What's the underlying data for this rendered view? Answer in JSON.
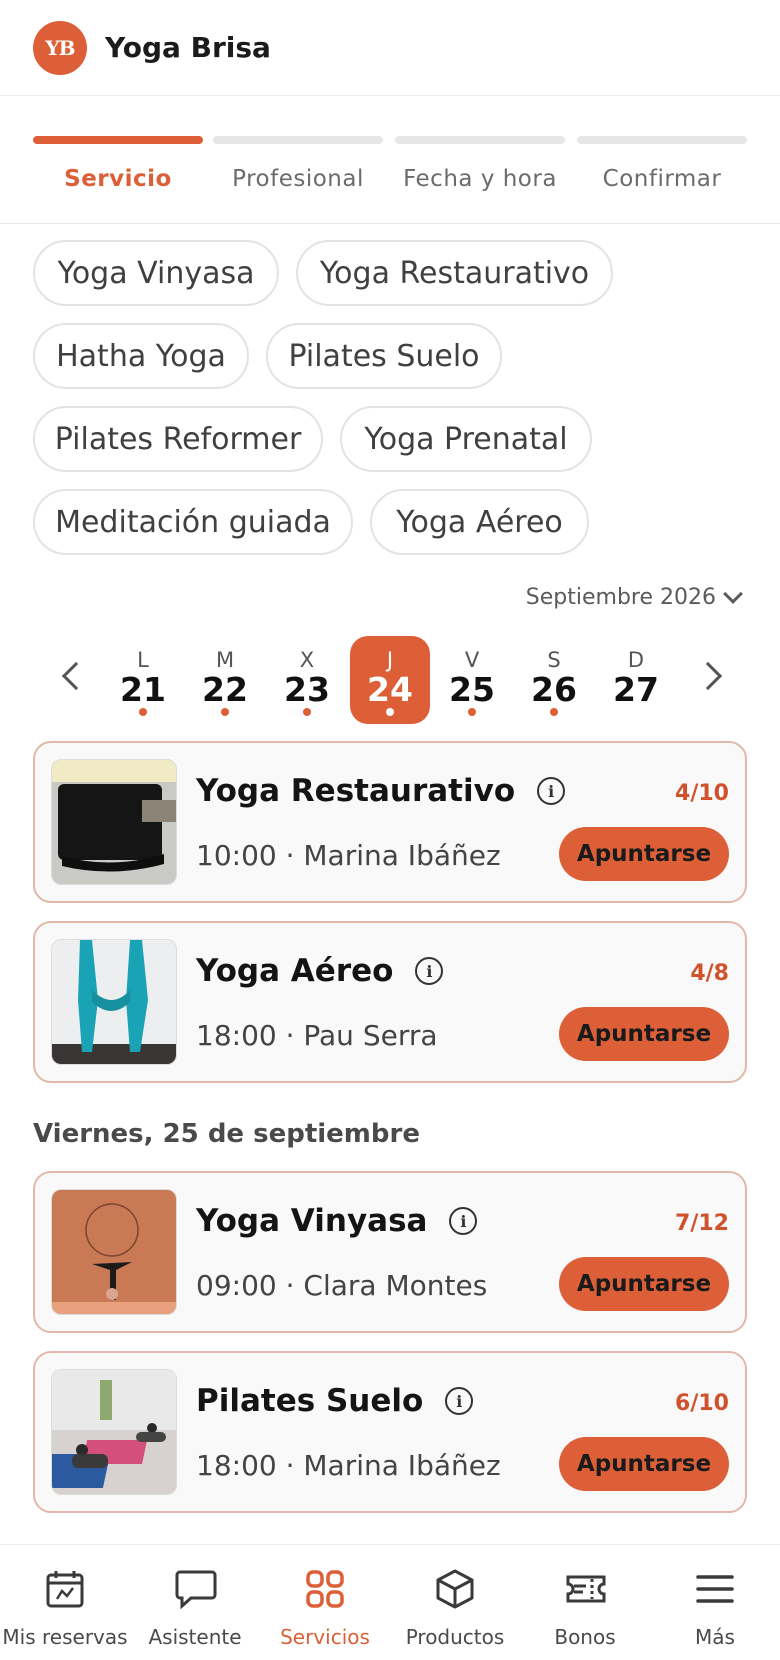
{
  "header": {
    "logo": "YB",
    "brand": "Yoga Brisa"
  },
  "steps": [
    {
      "label": "Servicio",
      "active": true
    },
    {
      "label": "Profesional",
      "active": false
    },
    {
      "label": "Fecha y hora",
      "active": false
    },
    {
      "label": "Confirmar",
      "active": false
    }
  ],
  "services": [
    "Yoga Vinyasa",
    "Yoga Restaurativo",
    "Hatha Yoga",
    "Pilates Suelo",
    "Pilates Reformer",
    "Yoga Prenatal",
    "Meditación guiada",
    "Yoga Aéreo"
  ],
  "calendar": {
    "month_label": "Septiembre 2026",
    "days": [
      {
        "letter": "L",
        "num": "21",
        "has_classes": true,
        "selected": false
      },
      {
        "letter": "M",
        "num": "22",
        "has_classes": true,
        "selected": false
      },
      {
        "letter": "X",
        "num": "23",
        "has_classes": true,
        "selected": false
      },
      {
        "letter": "J",
        "num": "24",
        "has_classes": true,
        "selected": true
      },
      {
        "letter": "V",
        "num": "25",
        "has_classes": true,
        "selected": false
      },
      {
        "letter": "S",
        "num": "26",
        "has_classes": true,
        "selected": false
      },
      {
        "letter": "D",
        "num": "27",
        "has_classes": false,
        "selected": false
      }
    ]
  },
  "classes": [
    {
      "name": "Yoga Restaurativo",
      "meta": "10:00 · Marina Ibáñez",
      "capacity": "4/10",
      "button": "Apuntarse",
      "image": "cushion-photo"
    },
    {
      "name": "Yoga Aéreo",
      "meta": "18:00 · Pau Serra",
      "capacity": "4/8",
      "button": "Apuntarse",
      "image": "aerial-silks-photo"
    },
    {
      "name": "Yoga Vinyasa",
      "meta": "09:00 · Clara Montes",
      "capacity": "7/12",
      "button": "Apuntarse",
      "image": "headstand-photo"
    },
    {
      "name": "Pilates Suelo",
      "meta": "18:00 · Marina Ibáñez",
      "capacity": "6/10",
      "button": "Apuntarse",
      "image": "mat-class-photo"
    }
  ],
  "day_heading": "Viernes, 25 de septiembre",
  "info_glyph": "i",
  "accent_color": "#dc5f37",
  "tabbar": [
    {
      "label": "Mis reservas",
      "icon": "calendar-icon",
      "active": false
    },
    {
      "label": "Asistente",
      "icon": "chat-bubble-icon",
      "active": false
    },
    {
      "label": "Servicios",
      "icon": "grid-icon",
      "active": true
    },
    {
      "label": "Productos",
      "icon": "box-icon",
      "active": false
    },
    {
      "label": "Bonos",
      "icon": "ticket-icon",
      "active": false
    },
    {
      "label": "Más",
      "icon": "menu-icon",
      "active": false
    }
  ]
}
